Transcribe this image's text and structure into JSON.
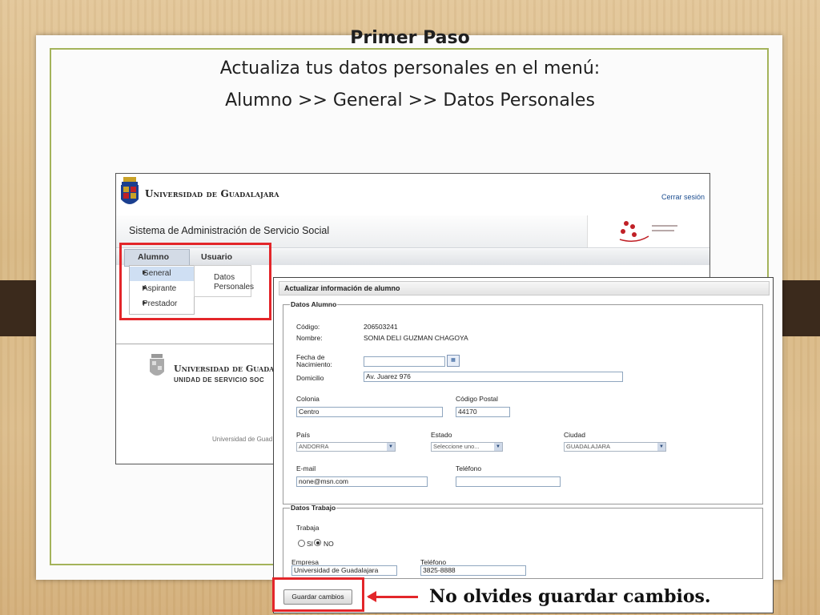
{
  "slide": {
    "title_line1": "Primer Paso",
    "title_line2": "Actualiza tus datos personales en el menú:",
    "title_line3": "Alumno >> General >> Datos Personales",
    "note": "No olvides guardar cambios."
  },
  "portal": {
    "university": "Universidad de Guadalajara",
    "logout": "Cerrar sesión",
    "system_title": "Sistema de Administración de Servicio Social",
    "menu": [
      "Alumno",
      "Usuario"
    ],
    "dropdown": [
      "General",
      "Aspirante",
      "Prestador"
    ],
    "submenu": [
      "Datos",
      "Personales"
    ],
    "footer_name": "Universidad de Guadalaj",
    "footer_unit": "UNIDAD DE SERVICIO SOC",
    "footer_small": "Universidad de Guad"
  },
  "form": {
    "window_title": "Actualizar información de alumno",
    "section1": "Datos Alumno",
    "codigo_label": "Código:",
    "codigo_value": "206503241",
    "nombre_label": "Nombre:",
    "nombre_value": "SONIA DELI GUZMAN CHAGOYA",
    "fecha_label1": "Fecha de",
    "fecha_label2": "Nacimiento:",
    "fecha_value": "",
    "domicilio_label": "Domicilio",
    "domicilio_value": "Av. Juarez 976",
    "colonia_label": "Colonia",
    "colonia_value": "Centro",
    "cp_label": "Código Postal",
    "cp_value": "44170",
    "pais_label": "País",
    "pais_value": "ANDORRA",
    "estado_label": "Estado",
    "estado_value": "Seleccione uno...",
    "ciudad_label": "Ciudad",
    "ciudad_value": "GUADALAJARA",
    "email_label": "E-mail",
    "email_value": "none@msn.com",
    "tel_label": "Teléfono",
    "tel_value": "",
    "section2": "Datos Trabajo",
    "trabaja_label": "Trabaja",
    "si_label": "SI",
    "no_label": "NO",
    "empresa_label": "Empresa",
    "empresa_value": "Universidad de Guadalajara",
    "tel2_label": "Teléfono",
    "tel2_value": "3825-8888",
    "save_button": "Guardar cambios"
  },
  "colors": {
    "highlight": "#e3262a",
    "frame": "#a4b35a",
    "link": "#1a4c8f"
  }
}
